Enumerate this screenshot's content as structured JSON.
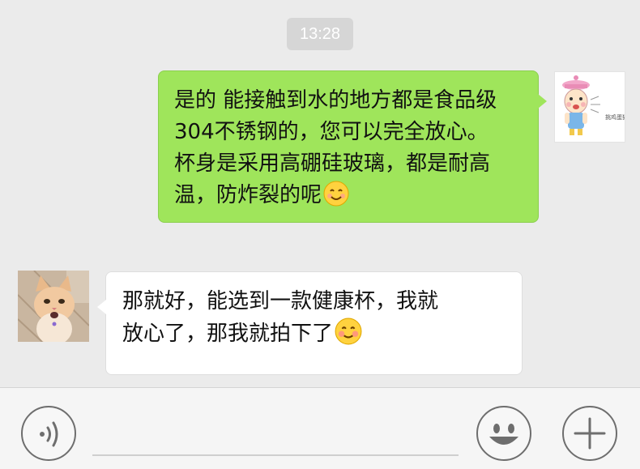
{
  "timestamp": "13:28",
  "messages": [
    {
      "side": "sent",
      "lines": [
        "是的 能接触到水的地方都是食品级",
        "304不锈钢的，您可以完全放心。",
        "杯身是采用高硼硅玻璃，都是耐高",
        "温，防炸裂的呢"
      ],
      "trailing_icon": "smile-emoji-icon",
      "avatar_text": "挑鸡蛋猫猫"
    },
    {
      "side": "received",
      "lines": [
        "那就好，能选到一款健康杯，我就",
        "放心了，那我就拍下了"
      ],
      "trailing_icon": "blush-smile-emoji-icon",
      "avatar": "cat-avatar"
    }
  ],
  "input_bar": {
    "left_button_icon": "voice-icon",
    "emoji_button_icon": "emoji-face-icon",
    "more_button_icon": "plus-icon"
  },
  "colors": {
    "background": "#ebebeb",
    "sent_bubble": "#9fe55b",
    "received_bubble": "#ffffff",
    "timestamp_bg": "#d6d6d6"
  }
}
